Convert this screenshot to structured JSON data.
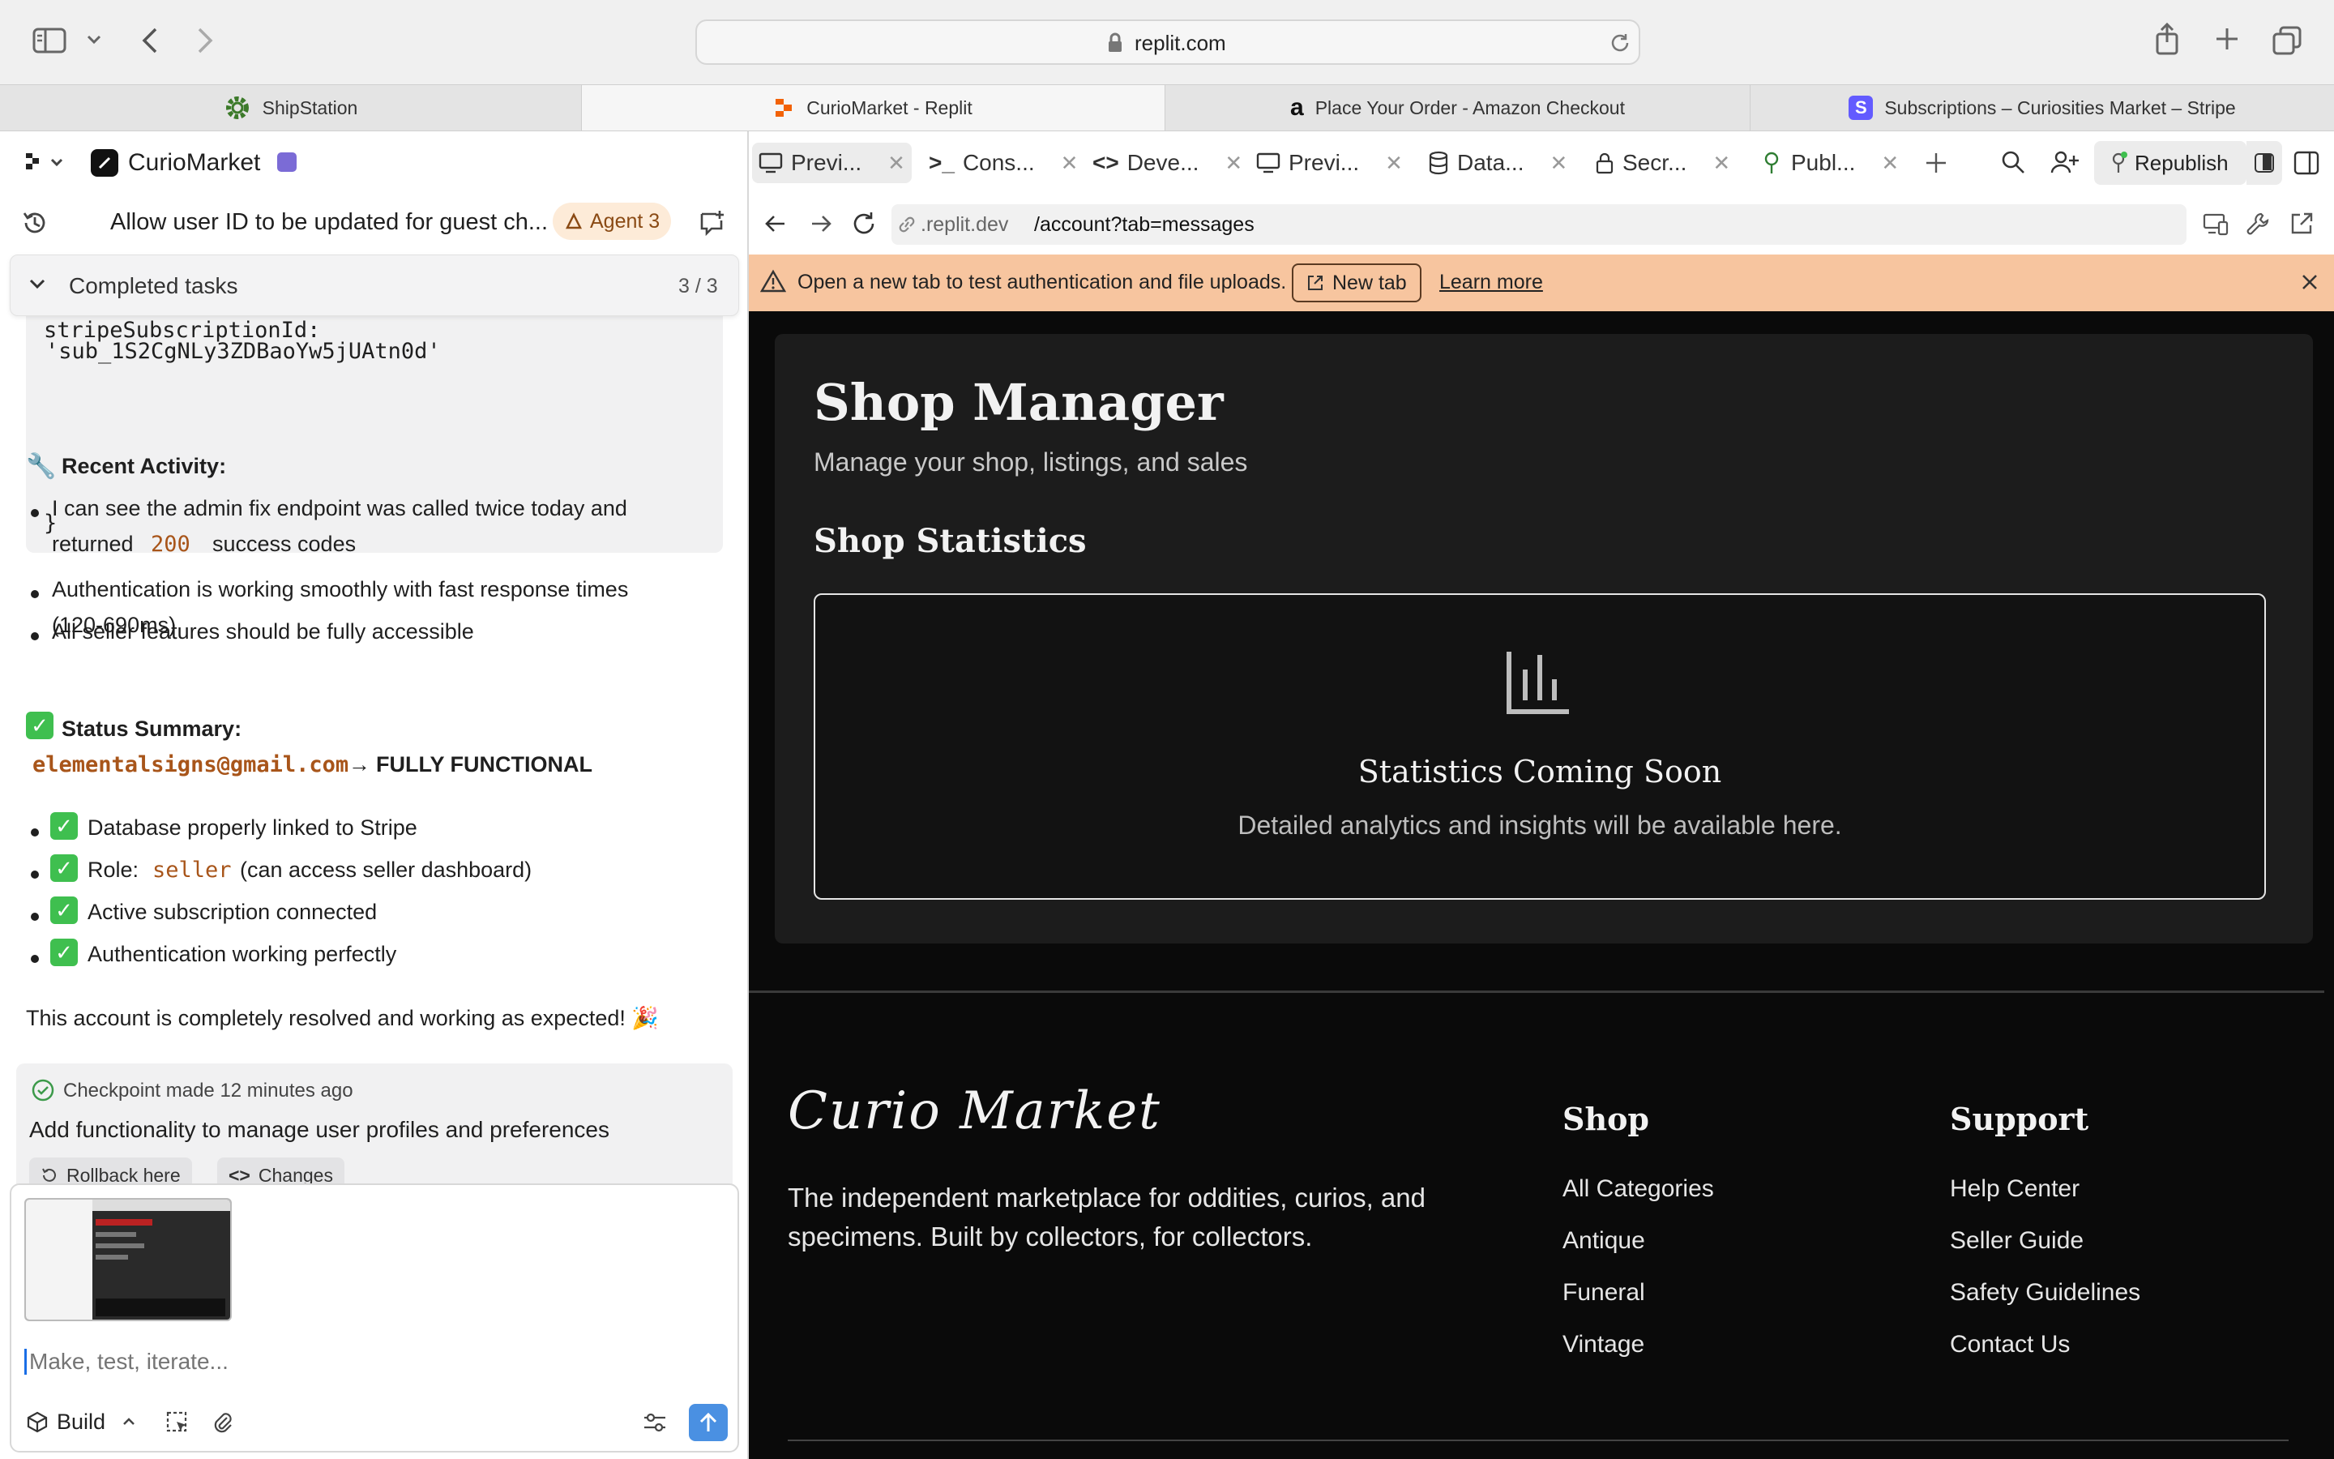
{
  "browser": {
    "url": "replit.com",
    "tabs": [
      {
        "label": "ShipStation",
        "icon": "gear-icon"
      },
      {
        "label": "CurioMarket - Replit",
        "icon": "replit-icon"
      },
      {
        "label": "Place Your Order - Amazon Checkout",
        "icon": "amazon-icon"
      },
      {
        "label": "Subscriptions – Curiosities Market – Stripe",
        "icon": "stripe-icon"
      }
    ]
  },
  "workspace": {
    "project_name": "CurioMarket",
    "task_title": "Allow user ID to be updated for guest ch...",
    "agent_badge": "Agent 3",
    "completed_tasks_label": "Completed tasks",
    "completed_tasks_count": "3 / 3"
  },
  "chat": {
    "code_line1": "  stripeSubscriptionId:",
    "code_line2": "'sub_1S2CgNLy3ZDBaoYw5jUAtn0d'",
    "code_line3": "}",
    "recent_activity_heading": "Recent Activity:",
    "activity_1a": "I can see the admin fix endpoint was called twice today and",
    "activity_1b_pre": "returned",
    "activity_1b_code": "200",
    "activity_1b_post": "success codes",
    "activity_2a": "Authentication is working smoothly with fast response times",
    "activity_2b": "(120-690ms)",
    "activity_3": "All seller features should be fully accessible",
    "status_heading": "Status Summary:",
    "status_email": "elementalsigns@gmail.com",
    "status_arrow": "→",
    "status_result": "FULLY FUNCTIONAL",
    "summary_1": "Database properly linked to Stripe",
    "summary_2_pre": "Role:",
    "summary_2_code": "seller",
    "summary_2_post": "(can access seller dashboard)",
    "summary_3": "Active subscription connected",
    "summary_4": "Authentication working perfectly",
    "closing": "This account is completely resolved and working as expected! 🎉",
    "checkpoint_label": "Checkpoint made 12 minutes ago",
    "checkpoint_desc": "Add functionality to manage user profiles and preferences",
    "rollback_label": "Rollback here",
    "changes_label": "Changes"
  },
  "composer": {
    "placeholder": "Make, test, iterate...",
    "mode_label": "Build"
  },
  "replit_tabs": [
    {
      "label": "Previ...",
      "icon": "monitor-icon"
    },
    {
      "label": "Cons...",
      "icon": "terminal-icon"
    },
    {
      "label": "Deve...",
      "icon": "code-icon"
    },
    {
      "label": "Previ...",
      "icon": "monitor-icon"
    },
    {
      "label": "Data...",
      "icon": "database-icon"
    },
    {
      "label": "Secr...",
      "icon": "lock-icon"
    },
    {
      "label": "Publ...",
      "icon": "publish-icon"
    }
  ],
  "replit_actions": {
    "republish_label": "Republish"
  },
  "preview_nav": {
    "address_domain": ".replit.dev",
    "address_path": "/account?tab=messages"
  },
  "banner": {
    "message": "Open a new tab to test authentication and file uploads.",
    "new_tab_label": "New tab",
    "learn_more_label": "Learn more"
  },
  "shop": {
    "title": "Shop Manager",
    "subtitle": "Manage your shop, listings, and sales",
    "stats_heading": "Shop Statistics",
    "coming_soon_title": "Statistics Coming Soon",
    "coming_soon_desc": "Detailed analytics and insights will be available here."
  },
  "footer": {
    "logo_text": "Curio Market",
    "tagline_1": "The independent marketplace for oddities, curios, and",
    "tagline_2": "specimens. Built by collectors, for collectors.",
    "shop_heading": "Shop",
    "shop_links": [
      "All Categories",
      "Antique",
      "Funeral",
      "Vintage"
    ],
    "support_heading": "Support",
    "support_links": [
      "Help Center",
      "Seller Guide",
      "Safety Guidelines",
      "Contact Us"
    ]
  },
  "colors": {
    "banner_bg": "#f7c59f",
    "code_orange": "#a8551a",
    "check_green": "#3fbf4f",
    "send_blue": "#4a90e2",
    "preview_bg": "#0a0a0a"
  }
}
